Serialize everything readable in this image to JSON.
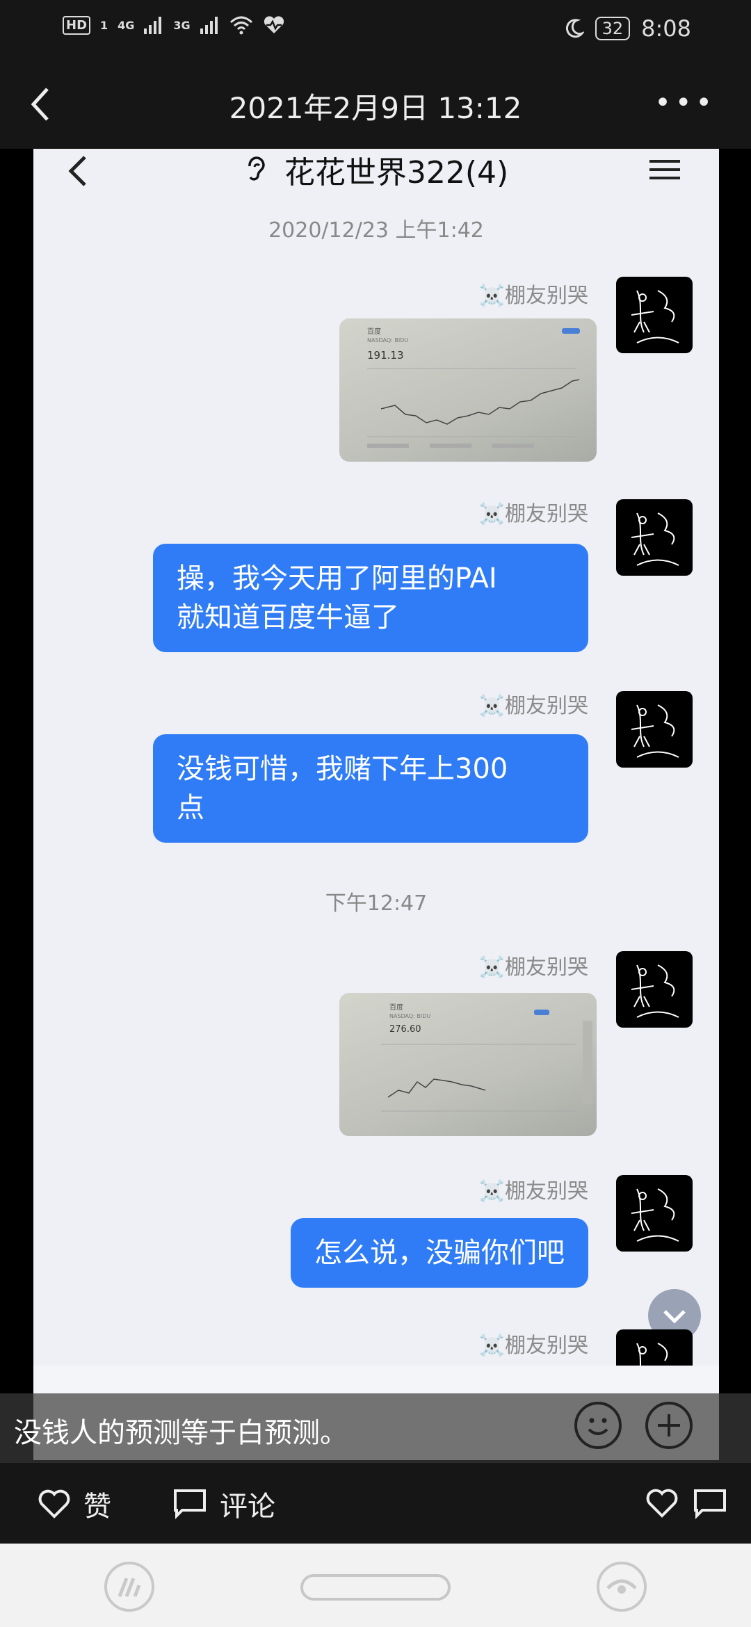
{
  "status_bar": {
    "hd": "HD",
    "sim1": "1",
    "net1": "4G",
    "net2": "3G",
    "battery": "32",
    "time": "8:08"
  },
  "header": {
    "title": "2021年2月9日 13:12",
    "back_icon": "chevron-left-icon",
    "more_icon": "more-dots-icon"
  },
  "chat": {
    "group_title": "花花世界322(4)",
    "timestamp_1": "2020/12/23 上午1:42",
    "timestamp_2": "下午12:47",
    "messages": [
      {
        "sender": "☠️棚友别哭",
        "type": "image"
      },
      {
        "sender": "☠️棚友别哭",
        "type": "text",
        "line1": "操，我今天用了阿里的PAI",
        "line2": "就知道百度牛逼了"
      },
      {
        "sender": "☠️棚友别哭",
        "type": "text",
        "line1": "没钱可惜，我赌下年上300",
        "line2": "点"
      },
      {
        "sender": "☠️棚友别哭",
        "type": "image"
      },
      {
        "sender": "☠️棚友别哭",
        "type": "text",
        "line1": "怎么说，没骗你们吧"
      },
      {
        "sender": "☠️棚友别哭",
        "type": "partial"
      }
    ],
    "img1": {
      "name": "百度",
      "ticker": "NASDAQ: BIDU",
      "price": "191.13"
    },
    "img2": {
      "name": "百度",
      "ticker": "NASDAQ: BIDU",
      "price": "276.60"
    }
  },
  "caption": "没钱人的预测等于白预测。",
  "actions": {
    "like_label": "赞",
    "comment_label": "评论"
  }
}
